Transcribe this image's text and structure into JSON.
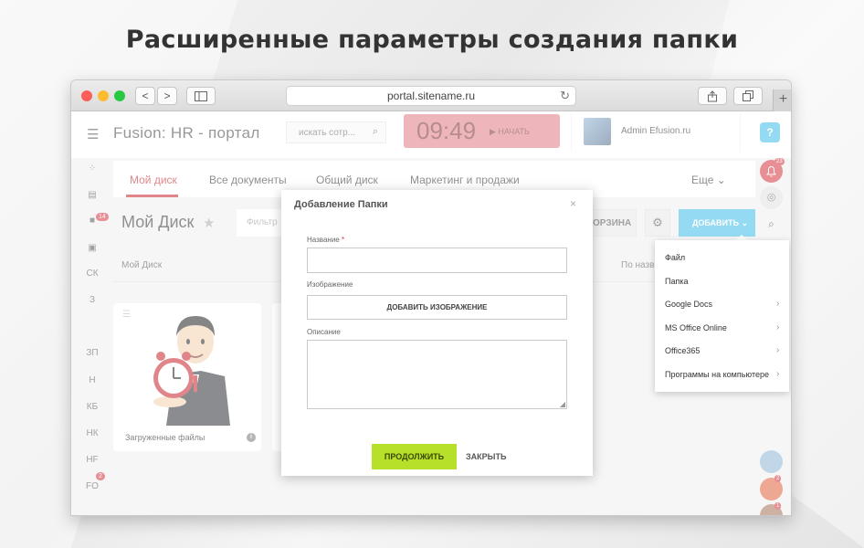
{
  "headline": "Расширенные параметры создания папки",
  "browser": {
    "url": "portal.sitename.ru",
    "nav_back": "<",
    "nav_forward": ">"
  },
  "topbar": {
    "app_title": "Fusion: HR - портал",
    "search_placeholder": "искать сотр...",
    "clock_time": "09:49",
    "clock_action": "НАЧАТЬ",
    "user_name": "Admin Efusion.ru",
    "help": "?"
  },
  "left_sidebar": {
    "badges": {
      "chat": "14",
      "fo": "2"
    },
    "labels": [
      "СК",
      "З",
      "ЗП",
      "Н",
      "КБ",
      "НК",
      "HF",
      "FO"
    ]
  },
  "tabs": [
    {
      "label": "Мой диск",
      "active": true
    },
    {
      "label": "Все документы",
      "active": false
    },
    {
      "label": "Общий диск",
      "active": false
    },
    {
      "label": "Маркетинг и продажи",
      "active": false
    }
  ],
  "tabs_more": "Еще",
  "right_sidebar": {
    "notifications_count": "23",
    "badge_a": "2",
    "badge_b": "1",
    "badge_c": "1"
  },
  "page": {
    "title": "Мой Диск",
    "filter_placeholder": "Фильтр",
    "trash_label": "ОРЗИНА",
    "add_label": "ДОБАВИТЬ",
    "breadcrumb": "Мой Диск",
    "sort_label": "По назв"
  },
  "card": {
    "caption": "Загруженные файлы",
    "info": "i"
  },
  "modal": {
    "title": "Добавление Папки",
    "name_label": "Название",
    "required_mark": "*",
    "image_label": "Изображение",
    "add_image_button": "ДОБАВИТЬ ИЗОБРАЖЕНИЕ",
    "description_label": "Описание",
    "continue_button": "ПРОДОЛЖИТЬ",
    "close_button": "ЗАКРЫТЬ"
  },
  "add_menu": [
    {
      "label": "Файл",
      "has_submenu": false
    },
    {
      "label": "Папка",
      "has_submenu": false
    },
    {
      "label": "Google Docs",
      "has_submenu": true
    },
    {
      "label": "MS Office Online",
      "has_submenu": true
    },
    {
      "label": "Office365",
      "has_submenu": true
    },
    {
      "label": "Программы на компьютере",
      "has_submenu": true
    }
  ],
  "colors": {
    "accent_red": "#c6232b",
    "clock_bg": "#e07b82",
    "primary_blue": "#3bbce8",
    "continue_green": "#b7e02a"
  }
}
